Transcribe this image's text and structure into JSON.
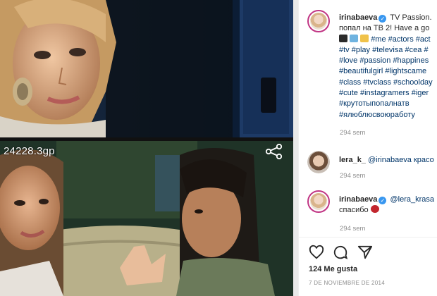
{
  "media": {
    "overlay_text": "24228.3gp",
    "share_icon": "share-nodes-icon"
  },
  "post": {
    "author": "irinabaeva",
    "caption_lines": [
      "TV Passion.",
      "попал на ТВ 2! Have a go",
      "#me #actors #act",
      "#tv #play #televisa #cea #",
      "#love #passion #happines",
      "#beautifulgirl #lightscame",
      "#class #tvclass #schoolday",
      "#cute #instagramers #iger",
      "#крутотыпопалнатв",
      "#ялюблюсвоюработу"
    ],
    "time": "294 sem"
  },
  "comments": [
    {
      "author": "lera_k_",
      "text": "@irinabaeva красо",
      "time": "294 sem"
    },
    {
      "author": "irinabaeva",
      "text_lines": [
        "@lera_krasa",
        "спасибо"
      ],
      "time": "294 sem"
    }
  ],
  "actions": {
    "likes": "124 Me gusta",
    "date": "7 DE NOVIEMBRE DE 2014",
    "icons": [
      "heart-icon",
      "comment-icon",
      "send-icon"
    ]
  },
  "colors": {
    "link": "#003569",
    "verified": "#3897f0",
    "meta": "#8e8e8e"
  }
}
